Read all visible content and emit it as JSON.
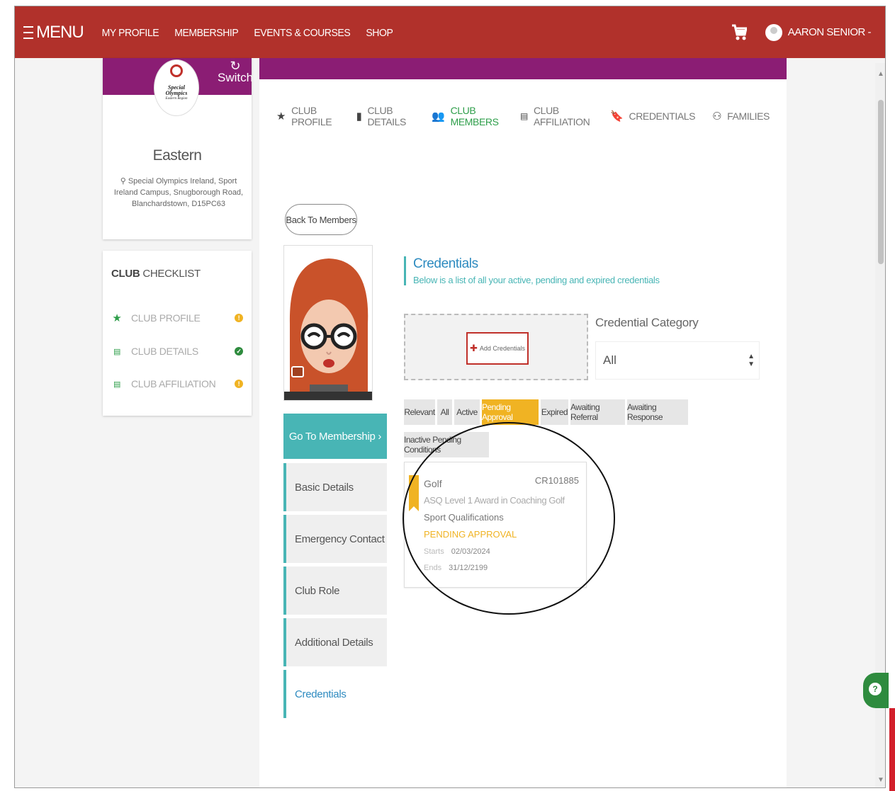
{
  "nav": {
    "menu_label": "MENU",
    "links": [
      "MY PROFILE",
      "MEMBERSHIP",
      "EVENTS & COURSES",
      "SHOP"
    ],
    "user_name": "AARON SENIOR",
    "user_caret": "-"
  },
  "club": {
    "logo_line1": "Special",
    "logo_line2": "Olympics",
    "logo_line3": "Eastern Region",
    "switch_label": "Switch",
    "name": "Eastern",
    "address": "Special Olympics Ireland, Sport Ireland Campus, Snugborough Road, Blanchardstown, D15PC63"
  },
  "checklist": {
    "title_bold": "CLUB",
    "title_rest": "CHECKLIST",
    "items": [
      {
        "label": "CLUB PROFILE",
        "status": "warn",
        "status_glyph": "!"
      },
      {
        "label": "CLUB DETAILS",
        "status": "ok",
        "status_glyph": "✓"
      },
      {
        "label": "CLUB AFFILIATION",
        "status": "warn",
        "status_glyph": "!"
      }
    ]
  },
  "subnav": {
    "items": [
      "CLUB PROFILE",
      "CLUB DETAILS",
      "CLUB MEMBERS",
      "CLUB AFFILIATION",
      "CREDENTIALS",
      "FAMILIES"
    ],
    "active": "CLUB MEMBERS"
  },
  "member": {
    "back_label": "Back To Members",
    "go_membership_label": "Go To Membership ›",
    "tabs": [
      "Basic Details",
      "Emergency Contact",
      "Club Role",
      "Additional Details",
      "Credentials"
    ],
    "active_tab": "Credentials"
  },
  "credentials": {
    "title": "Credentials",
    "subtitle": "Below is a list of all your active, pending and expired credentials",
    "add_label": "Add Credentials",
    "category_label": "Credential Category",
    "category_value": "All",
    "filters": [
      "Relevant",
      "All",
      "Active",
      "Pending Approval",
      "Expired",
      "Awaiting Referral",
      "Awaiting Response",
      "Inactive Pending Conditions"
    ],
    "active_filter": "Pending Approval",
    "card": {
      "sport": "Golf",
      "id": "CR101885",
      "name": "ASQ Level 1 Award in Coaching Golf",
      "type": "Sport Qualifications",
      "status": "PENDING APPROVAL",
      "starts_label": "Starts",
      "starts": "02/03/2024",
      "ends_label": "Ends",
      "ends": "31/12/2199"
    }
  },
  "colors": {
    "nav_red": "#b1312b",
    "purple": "#8b1d74",
    "teal": "#48b5b5",
    "green": "#2e9e4a",
    "amber": "#f0b323",
    "blue": "#2e8bc0"
  }
}
